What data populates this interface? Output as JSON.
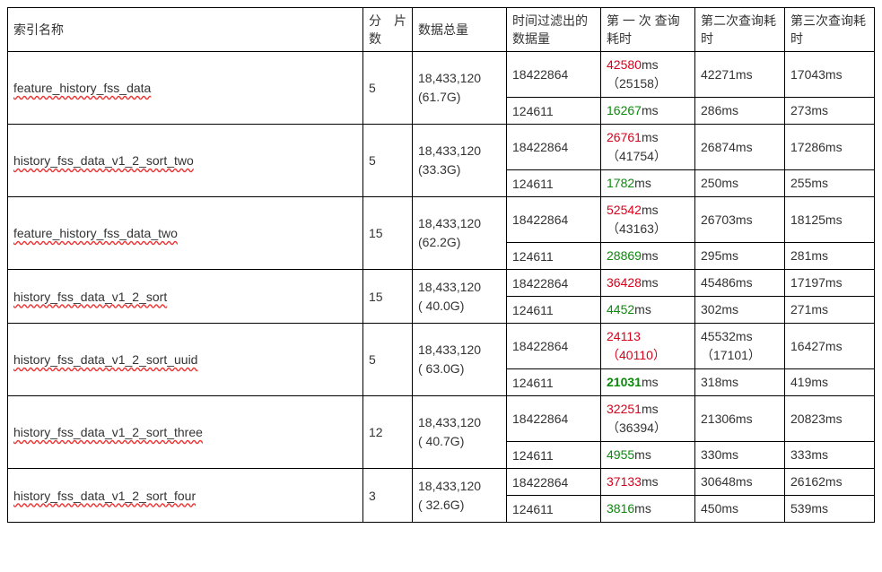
{
  "headers": {
    "index_name": "索引名称",
    "shard_count": "分　片数",
    "total_data": "数据总量",
    "filtered_by_time": "时间过滤出的数据量",
    "first_query": "第 一 次 查询耗时",
    "second_query": "第二次查询耗时",
    "third_query": "第三次查询耗时"
  },
  "unit_ms": "ms",
  "rows": [
    {
      "name": "feature_history_fss_data",
      "shards": "5",
      "total_count": "18,433,120",
      "total_size": "(61.7G)",
      "sub": [
        {
          "filtered": "18422864",
          "first_main": "42580",
          "first_paren": "（25158）",
          "second_main": "42271",
          "third_main": "17043"
        },
        {
          "filtered": "124611",
          "first_main": "16267",
          "first_class": "num-green",
          "second_main": "286",
          "third_main": "273"
        }
      ]
    },
    {
      "name": "history_fss_data_v1_2_sort_two",
      "shards": "5",
      "total_count": "18,433,120",
      "total_size": "(33.3G)",
      "sub": [
        {
          "filtered": "18422864",
          "first_main": "26761",
          "first_paren": "（41754）",
          "second_main": "26874",
          "third_main": "17286"
        },
        {
          "filtered": "124611",
          "first_main": "1782",
          "first_class": "num-green",
          "second_main": "250",
          "third_main": "255"
        }
      ]
    },
    {
      "name": "feature_history_fss_data_two",
      "shards": "15",
      "total_count": "18,433,120",
      "total_size": "(62.2G)",
      "sub": [
        {
          "filtered": "18422864",
          "first_main": "52542",
          "first_paren": "（43163）",
          "second_main": "26703",
          "third_main": "18125"
        },
        {
          "filtered": "124611",
          "first_main": "28869",
          "first_class": "num-green",
          "second_main": "295",
          "third_main": "281"
        }
      ]
    },
    {
      "name": "history_fss_data_v1_2_sort",
      "shards": "15",
      "total_count": "18,433,120",
      "total_size": "( 40.0G)",
      "sub": [
        {
          "filtered": "18422864",
          "first_main": "36428",
          "second_main": "45486",
          "third_main": "17197"
        },
        {
          "filtered": "124611",
          "first_main": "4452",
          "first_class": "num-green",
          "second_main": "302",
          "third_main": "271"
        }
      ]
    },
    {
      "name": "history_fss_data_v1_2_sort_uuid",
      "shards": "5",
      "total_count": "18,433,120",
      "total_size": "( 63.0G)",
      "sub": [
        {
          "filtered": "18422864",
          "first_main": "24113",
          "first_no_ms": true,
          "first_paren": "（40110）",
          "first_paren_class": "num-red",
          "second_main": "45532",
          "second_paren": "（17101）",
          "third_main": "16427"
        },
        {
          "filtered": "124611",
          "first_main": "21031",
          "first_class": "num-green-bold",
          "second_main": "318",
          "third_main": "419"
        }
      ]
    },
    {
      "name": "history_fss_data_v1_2_sort_three",
      "shards": "12",
      "total_count": "18,433,120",
      "total_size": "( 40.7G)",
      "sub": [
        {
          "filtered": "18422864",
          "first_main": "32251",
          "first_paren": "（36394）",
          "second_main": "21306",
          "third_main": "20823"
        },
        {
          "filtered": "124611",
          "first_main": "4955",
          "first_class": "num-green",
          "second_main": "330",
          "third_main": "333"
        }
      ]
    },
    {
      "name": "history_fss_data_v1_2_sort_four",
      "shards": "3",
      "total_count": "18,433,120",
      "total_size": "( 32.6G)",
      "sub": [
        {
          "filtered": "18422864",
          "first_main": "37133",
          "second_main": "30648",
          "third_main": "26162"
        },
        {
          "filtered": "124611",
          "first_main": "3816",
          "first_class": "num-green",
          "second_main": "450",
          "third_main": "539"
        }
      ]
    }
  ]
}
